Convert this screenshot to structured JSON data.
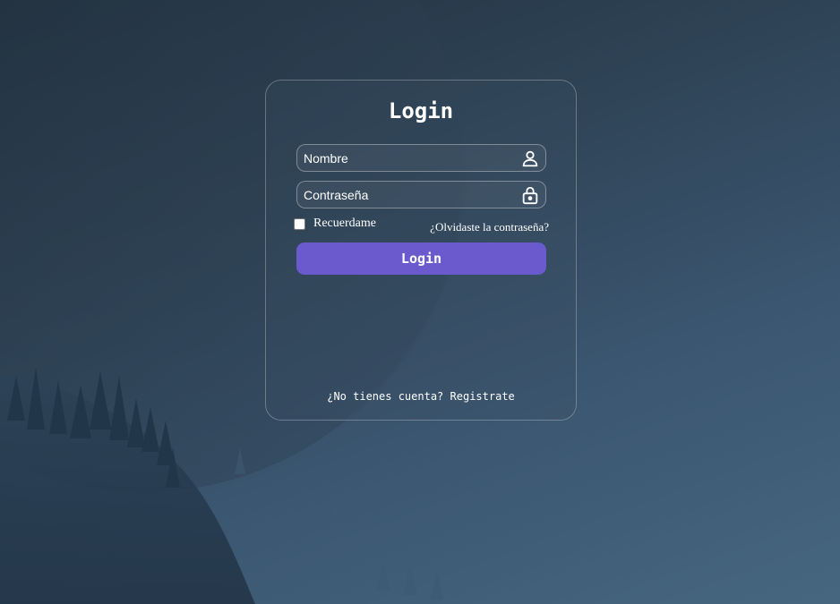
{
  "login_form": {
    "title": "Login",
    "username": {
      "placeholder": "Nombre",
      "value": "",
      "icon": "user-icon"
    },
    "password": {
      "placeholder": "Contraseña",
      "value": "",
      "icon": "lock-icon"
    },
    "remember_label": "Recuerdame",
    "remember_checked": false,
    "forgot_label": "¿Olvidaste la contraseña?",
    "submit_label": "Login",
    "register_prompt": "¿No tienes cuenta?",
    "register_link": "Registrate"
  },
  "colors": {
    "accent": "#6a5acd",
    "background": "#3b5670",
    "text": "#ffffff"
  }
}
